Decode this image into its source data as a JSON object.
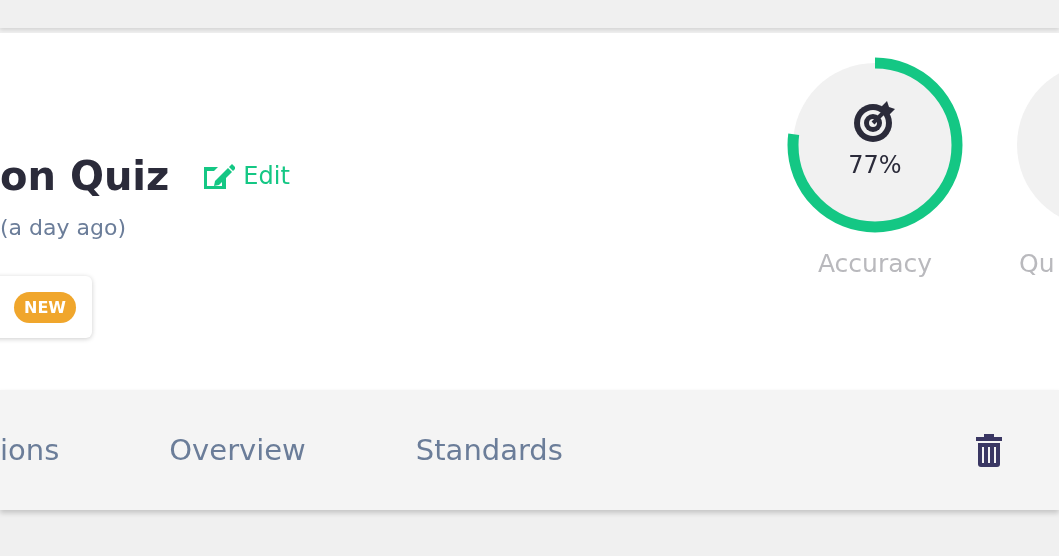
{
  "header": {
    "title": "on Quiz",
    "edit_link": "Edit",
    "subtitle": "(a day ago)",
    "badge": "NEW"
  },
  "metrics": [
    {
      "label": "Accuracy",
      "value": "77%",
      "level": 0.77
    },
    {
      "label": "Qu"
    }
  ],
  "tabs": [
    {
      "label": "ions",
      "selected": false
    },
    {
      "label": "Overview",
      "selected": false
    },
    {
      "label": "Standards",
      "selected": false
    }
  ]
}
